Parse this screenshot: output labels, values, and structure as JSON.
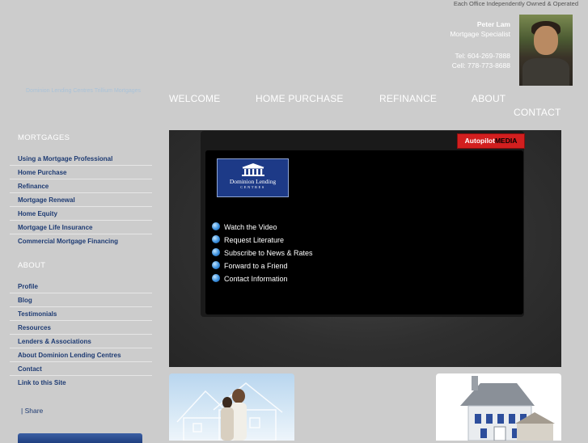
{
  "header": {
    "tagline": "Each Office Independently Owned & Operated",
    "brand_link": "Dominion Lending Centres Trillium Mortgages",
    "agent": {
      "name": "Peter Lam",
      "title": "Mortgage Specialist",
      "tel": "Tel: 604-269-7888",
      "cell": "Cell: 778-773-8688"
    }
  },
  "nav": {
    "welcome": "WELCOME",
    "home_purchase": "HOME PURCHASE",
    "refinance": "REFINANCE",
    "about": "ABOUT",
    "contact": "CONTACT"
  },
  "sidebar": {
    "mortgages_heading": "MORTGAGES",
    "mortgages": [
      "Using a Mortgage Professional",
      "Home Purchase",
      "Refinance",
      "Mortgage Renewal",
      "Home Equity",
      "Mortgage Life Insurance",
      "Commercial Mortgage Financing"
    ],
    "about_heading": "ABOUT",
    "about": [
      "Profile",
      "Blog",
      "Testimonials",
      "Resources",
      "Lenders & Associations",
      "About Dominion Lending Centres",
      "Contact",
      "Link to this Site"
    ],
    "share": "| Share"
  },
  "player": {
    "badge_prefix": "Autopilot",
    "badge_suffix": "MEDIA",
    "logo_line1": "Dominion Lending",
    "logo_line2": "CENTRES",
    "menu": [
      "Watch the Video",
      "Request Literature",
      "Subscribe to News & Rates",
      "Forward to a Friend",
      "Contact Information"
    ]
  },
  "colors": {
    "page_bg": "#cccccc",
    "sidebar_link": "#1e3b73",
    "badge_red": "#d21f1f",
    "logo_blue": "#1d3a87"
  }
}
